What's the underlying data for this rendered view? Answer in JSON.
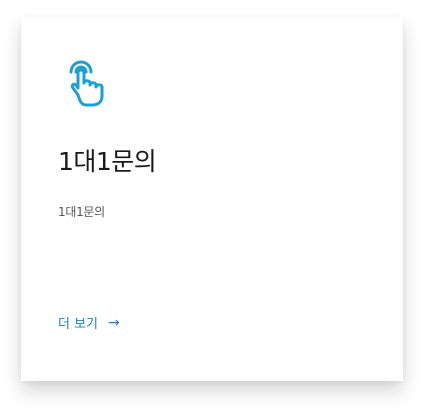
{
  "card": {
    "icon": "tap-hand-icon",
    "title": "1대1문의",
    "description": "1대1문의",
    "more_label": "더 보기",
    "more_arrow": "→"
  },
  "colors": {
    "accent": "#1a9fd6",
    "link": "#1f7fb8",
    "title": "#1a1a1a",
    "text": "#555555"
  }
}
